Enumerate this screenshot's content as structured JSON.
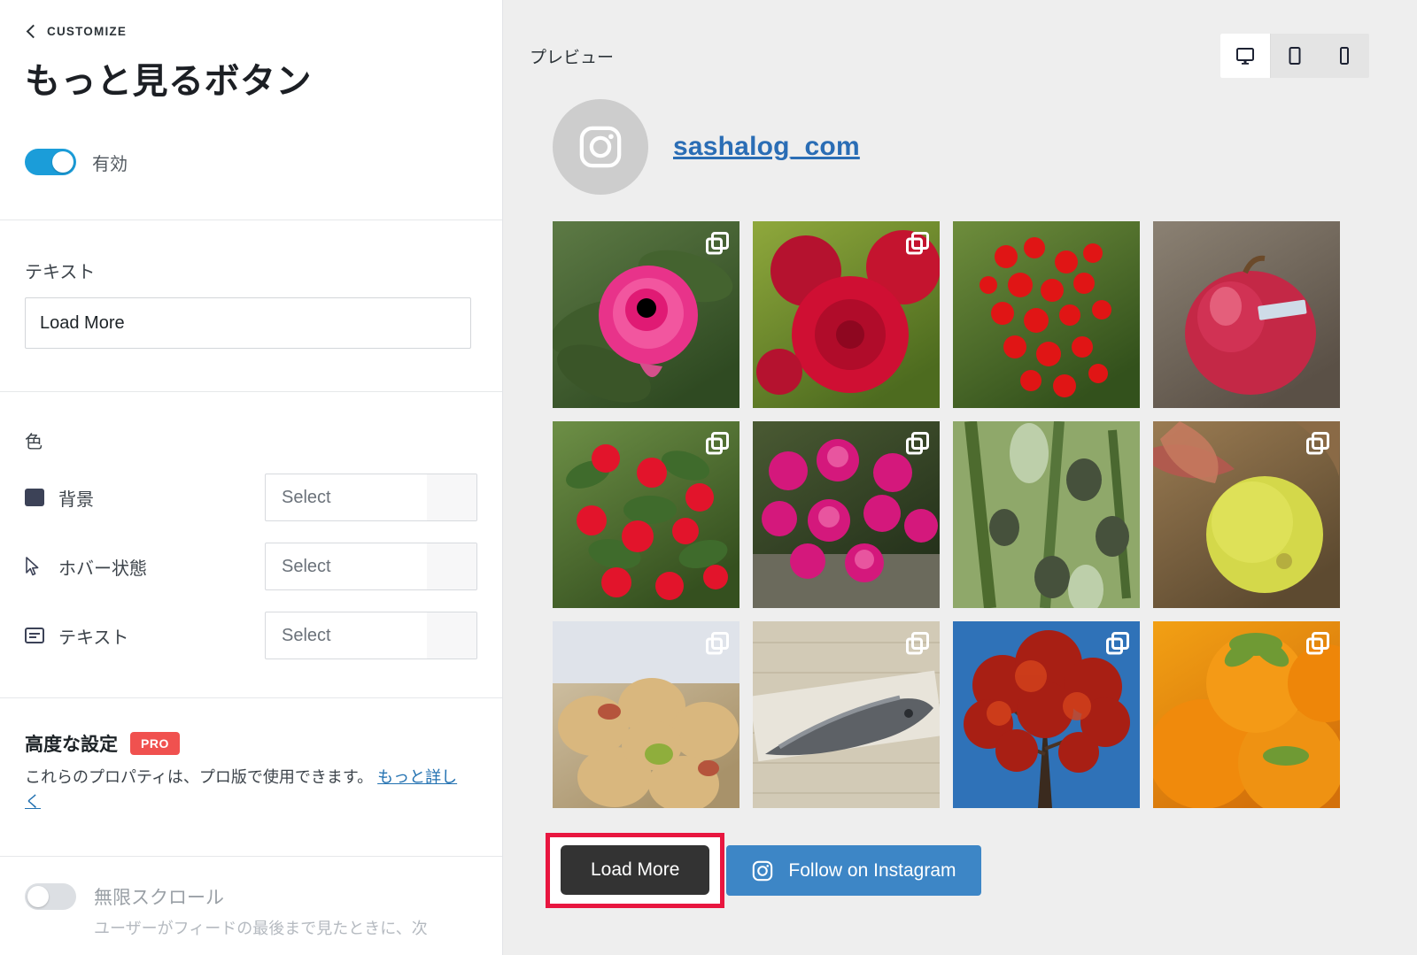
{
  "sidebar": {
    "breadcrumb": "CUSTOMIZE",
    "title": "もっと見るボタン",
    "enabled_toggle": {
      "label": "有効",
      "state": "on"
    },
    "text_section": {
      "label": "テキスト",
      "value": "Load More"
    },
    "color_section": {
      "label": "色",
      "rows": [
        {
          "icon": "color-swatch-icon",
          "label": "背景",
          "value": "Select"
        },
        {
          "icon": "cursor-pointer-icon",
          "label": "ホバー状態",
          "value": "Select"
        },
        {
          "icon": "text-box-icon",
          "label": "テキスト",
          "value": "Select"
        }
      ]
    },
    "advanced": {
      "title": "高度な設定",
      "badge": "PRO",
      "description": "これらのプロパティは、プロ版で使用できます。",
      "link": "もっと詳しく"
    },
    "infinite_scroll": {
      "label": "無限スクロール",
      "description": "ユーザーがフィードの最後まで見たときに、次",
      "state": "off"
    }
  },
  "preview": {
    "label": "プレビュー",
    "devices": [
      {
        "name": "desktop",
        "active": true
      },
      {
        "name": "tablet",
        "active": false
      },
      {
        "name": "mobile",
        "active": false
      }
    ],
    "account": {
      "username": "sashalog_com",
      "avatar_icon": "instagram-icon"
    },
    "grid": [
      {
        "alt": "pink-camellia-flower",
        "carousel": true,
        "c1": "#5d7a45",
        "c2": "#2f4a22",
        "subject": "camellia"
      },
      {
        "alt": "red-chrysanthemum",
        "carousel": true,
        "c1": "#8fa83c",
        "c2": "#4d6b1f",
        "subject": "chrysanthemum"
      },
      {
        "alt": "red-berries-cluster",
        "carousel": false,
        "c1": "#6e8d3c",
        "c2": "#33511c",
        "subject": "berries"
      },
      {
        "alt": "red-apple-with-label",
        "carousel": false,
        "c1": "#8b8173",
        "c2": "#5a5046",
        "subject": "apple"
      },
      {
        "alt": "cotoneaster-berries",
        "carousel": true,
        "c1": "#6d8f46",
        "c2": "#35501f",
        "subject": "cotoneaster"
      },
      {
        "alt": "pink-cyclamen-shop",
        "carousel": true,
        "c1": "#4a5a33",
        "c2": "#23301a",
        "subject": "cyclamen"
      },
      {
        "alt": "green-olives-on-tree",
        "carousel": false,
        "c1": "#7d9a4a",
        "c2": "#3d5524",
        "subject": "olives"
      },
      {
        "alt": "yellow-quince-fruit",
        "carousel": true,
        "c1": "#9a7b52",
        "c2": "#5d4a30",
        "subject": "quince"
      },
      {
        "alt": "cooked-potato-dish",
        "carousel": true,
        "c1": "#d8cbb0",
        "c2": "#a8926a",
        "subject": "dish"
      },
      {
        "alt": "fish-on-newspaper",
        "carousel": true,
        "c1": "#cfc6b4",
        "c2": "#8e8470",
        "subject": "fish"
      },
      {
        "alt": "autumn-maple-tree",
        "carousel": true,
        "c1": "#2f72b8",
        "c2": "#8e2417",
        "subject": "maple"
      },
      {
        "alt": "orange-persimmons",
        "carousel": true,
        "c1": "#f2a014",
        "c2": "#d3700a",
        "subject": "persimmon"
      }
    ],
    "load_more_button": "Load More",
    "follow_button": "Follow on Instagram",
    "highlight_color": "#e8163f"
  }
}
